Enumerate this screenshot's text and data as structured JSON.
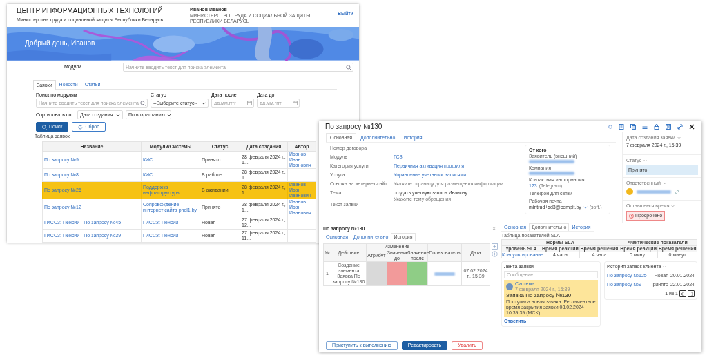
{
  "portal": {
    "header": {
      "title": "ЦЕНТР ИНФОРМАЦИОННЫХ ТЕХНОЛОГИЙ",
      "subtitle": "Министерства труда и социальной защиты Республики Беларусь",
      "user_name": "Иванов Иванов",
      "user_org": "МИНИСТЕРСТВО ТРУДА И СОЦИАЛЬНОЙ ЗАЩИТЫ РЕСПУБЛИКИ БЕЛАРУСЬ",
      "logout": "Выйти"
    },
    "banner": {
      "kind": "picture",
      "greeting": "Добрый день, Иванов"
    },
    "modules": {
      "label": "Модули",
      "placeholder": "Начните вводить текст для поиска элемента"
    },
    "tabs": [
      {
        "label": "Заявки",
        "selected": true
      },
      {
        "label": "Новости",
        "selected": false
      },
      {
        "label": "Статьи",
        "selected": false
      }
    ],
    "filters": [
      {
        "kind": "search",
        "label": "Поиск по модулям",
        "placeholder": "Начните вводить текст для поиска элемента"
      },
      {
        "kind": "select",
        "label": "Статус",
        "value": "--Выберите статус--"
      },
      {
        "kind": "date",
        "label": "Дата после",
        "placeholder": "дд.мм.гггг"
      },
      {
        "kind": "date",
        "label": "Дата до",
        "placeholder": "дд.мм.гггг"
      }
    ],
    "sort": {
      "label": "Сортировать по",
      "selects": [
        "Дата создания",
        "По возрастанию"
      ]
    },
    "actions": [
      {
        "kind": "primary",
        "label": "Поиск"
      },
      {
        "kind": "secondary",
        "label": "Сброс"
      }
    ],
    "table": {
      "caption": "Таблица заявок",
      "columns": [
        "Название",
        "Модули/Системы",
        "Статус",
        "Дата создания",
        "Автор"
      ],
      "rows": [
        {
          "selected": false,
          "cells": [
            "По запросу №9",
            "КИС",
            "Принято",
            "28 февраля 2024 г., 1...",
            "Иванов Иван Иванович"
          ]
        },
        {
          "selected": false,
          "cells": [
            "По запросу №8",
            "КИС",
            "В работе",
            "28 февраля 2024 г., 1..."
          ]
        },
        {
          "selected": true,
          "cells": [
            "По запросу №26",
            "Поддержка инфраструктуры",
            "В ожидании",
            "28 февраля 2024 г., 1...",
            "Иванов Иван Иванович"
          ]
        },
        {
          "selected": false,
          "cells": [
            "По запросу №12",
            "Сопровождение интернет сайта pndl1.by",
            "Принято",
            "28 февраля 2024 г., 1...",
            "Иванов Иван Иванович"
          ]
        },
        {
          "selected": false,
          "cells": [
            "ГИССЗ: Пенсии - По запросу №45",
            "ГИССЗ: Пенсии",
            "Новая",
            "27 февраля 2024 г., 12..."
          ]
        },
        {
          "selected": false,
          "cells": [
            "ГИССЗ: Пенсии - По запросу №39",
            "ГИССЗ: Пенсии",
            "Новая",
            "27 февраля 2024 г., 11..."
          ]
        }
      ]
    }
  },
  "ticket": {
    "title": "По запросу №130",
    "tabs": [
      {
        "label": "Основная",
        "selected": true
      },
      {
        "label": "Дополнительно",
        "selected": false
      },
      {
        "label": "История",
        "selected": false
      }
    ],
    "fields": [
      {
        "label": "Номер договора"
      },
      {
        "label": "Модуль",
        "kind": "link",
        "value": "ГСЗ"
      },
      {
        "label": "Категория услуги",
        "kind": "link",
        "value": "Первичная активация профиля"
      },
      {
        "label": "Услуга",
        "kind": "link",
        "value": "Управление учетными записями"
      },
      {
        "label": "Ссылка на интернет-сайт",
        "hint": "Укажите страницу для размещения информации"
      },
      {
        "label": "Тема",
        "kind": "text",
        "value": "создать учетную запись Иванову",
        "hint": "Укажите тему обращения"
      },
      {
        "label": "Текст заявки"
      }
    ],
    "contact": {
      "title": "От кого",
      "items": [
        {
          "label": "Заявитель (внешний)",
          "blurred": true
        },
        {
          "label": "Компания",
          "blurred": true
        },
        {
          "label": "Контактная информация",
          "value": "123",
          "note": "(Telegram)"
        },
        {
          "label": "Телефон для связи"
        },
        {
          "label": "Рабочая почта",
          "value": "mintrud+sd3@compit.by",
          "dropdown": true,
          "note": "(soft.)"
        }
      ]
    },
    "side": [
      {
        "kind": "text",
        "label": "Дата создания заявки",
        "value": "7 февраля 2024 г., 15:39"
      },
      {
        "kind": "status",
        "label": "Статус",
        "value": "Принято"
      },
      {
        "kind": "person",
        "label": "Ответственный"
      },
      {
        "kind": "alert",
        "label": "Оставшееся время",
        "value": "Просрочено"
      }
    ],
    "history_popup": {
      "title": "По запросу №130",
      "close": "×",
      "tabs": [
        {
          "label": "Основная",
          "selected": false
        },
        {
          "label": "Дополнительно",
          "selected": false
        },
        {
          "label": "История",
          "selected": true
        }
      ],
      "group": "Изменение",
      "columns": [
        "№",
        "Действие",
        "Атрибут",
        "Значение до",
        "Значение после",
        "Пользователь",
        "Дата"
      ],
      "rows": [
        {
          "number": "1",
          "action": "Создание элемента Заявка По запросу №130",
          "attribute": "-",
          "before": "-",
          "after": "-",
          "date": "07.02.2024 г., 15:39"
        }
      ]
    },
    "sla": {
      "tabs": [
        {
          "label": "Основная",
          "selected": false
        },
        {
          "label": "Дополнительно",
          "selected": true
        },
        {
          "label": "История",
          "selected": false
        }
      ],
      "caption": "Таблица показателей SLA",
      "groups": [
        "Нормы SLA",
        "Фактические показатели"
      ],
      "columns": [
        "Уровень SLA",
        "Время реакции",
        "Время решения",
        "Время реакции",
        "Время решения"
      ],
      "row": [
        "Консультирование",
        "4 часа",
        "4 часа",
        "0 минут",
        "0 минут"
      ]
    },
    "feed": {
      "title": "Лента заявки",
      "placeholder": "Сообщение",
      "entries": [
        {
          "author": "Система",
          "date": "7 февраля 2024 г., 15:39",
          "title": "Заявка По запросу №130",
          "text": "Поступила новая заявка. Регламентное время закрытия заявки 08.02.2024 10:39:39 (MCK).",
          "reply": "Ответить"
        }
      ]
    },
    "client_history": {
      "title": "История заявок клиента",
      "items": [
        {
          "name": "По запросу №125",
          "status": "Новая",
          "date": "20.01.2024"
        },
        {
          "name": "По запросу №9",
          "status": "Принято",
          "date": "22.01.2024"
        }
      ],
      "pager": "1 из 1"
    },
    "footer": [
      {
        "kind": "outline",
        "label": "Приступить к выполнению"
      },
      {
        "kind": "primary",
        "label": "Редактировать"
      },
      {
        "kind": "danger",
        "label": "Удалить"
      }
    ]
  }
}
